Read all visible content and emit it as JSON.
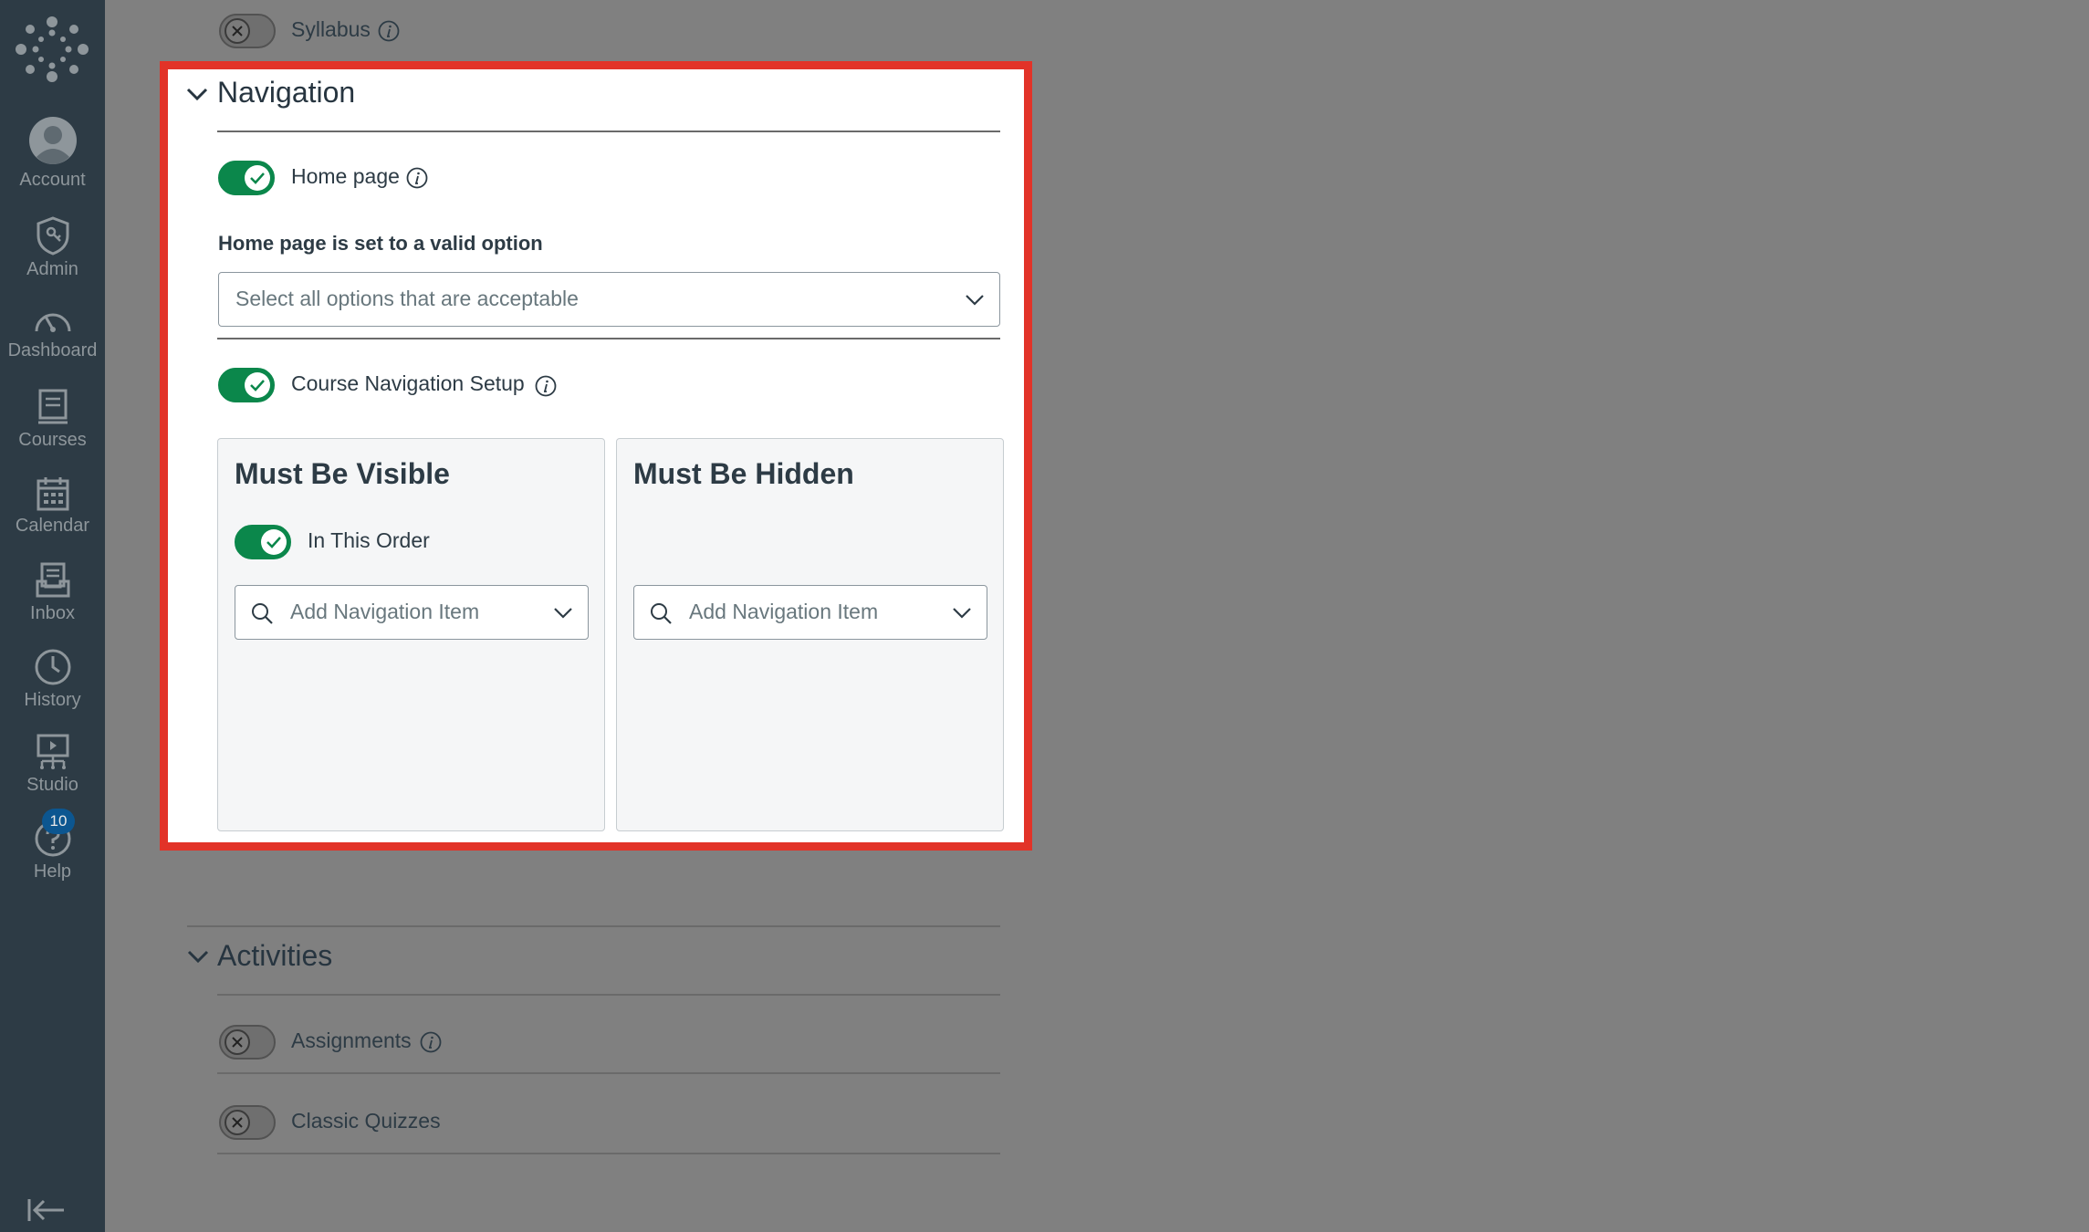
{
  "nav": {
    "items": [
      {
        "label": "Account",
        "icon": "account-icon"
      },
      {
        "label": "Admin",
        "icon": "admin-icon"
      },
      {
        "label": "Dashboard",
        "icon": "dashboard-icon"
      },
      {
        "label": "Courses",
        "icon": "courses-icon"
      },
      {
        "label": "Calendar",
        "icon": "calendar-icon"
      },
      {
        "label": "Inbox",
        "icon": "inbox-icon"
      },
      {
        "label": "History",
        "icon": "history-icon"
      },
      {
        "label": "Studio",
        "icon": "studio-icon"
      },
      {
        "label": "Help",
        "icon": "help-icon"
      }
    ],
    "help_badge": "10"
  },
  "syllabus": {
    "label": "Syllabus",
    "enabled": false
  },
  "navigation_section": {
    "title": "Navigation",
    "home_page": {
      "label": "Home page",
      "enabled": true
    },
    "home_valid_heading": "Home page is set to a valid option",
    "home_select": {
      "placeholder": "Select all options that are acceptable"
    },
    "course_nav": {
      "label": "Course Navigation Setup",
      "enabled": true
    },
    "visible_panel": {
      "title": "Must Be Visible",
      "order_toggle": {
        "label": "In This Order",
        "enabled": true
      },
      "add_placeholder": "Add Navigation Item"
    },
    "hidden_panel": {
      "title": "Must Be Hidden",
      "add_placeholder": "Add Navigation Item"
    }
  },
  "activities_section": {
    "title": "Activities",
    "items": [
      {
        "label": "Assignments",
        "enabled": false,
        "has_info": true
      },
      {
        "label": "Classic Quizzes",
        "enabled": false,
        "has_info": false
      }
    ]
  },
  "colors": {
    "sidebar": "#2d3b45",
    "backdrop": "#808080",
    "toggle_on": "#0b874b",
    "highlight": "#e23328",
    "badge": "#0c5690"
  }
}
